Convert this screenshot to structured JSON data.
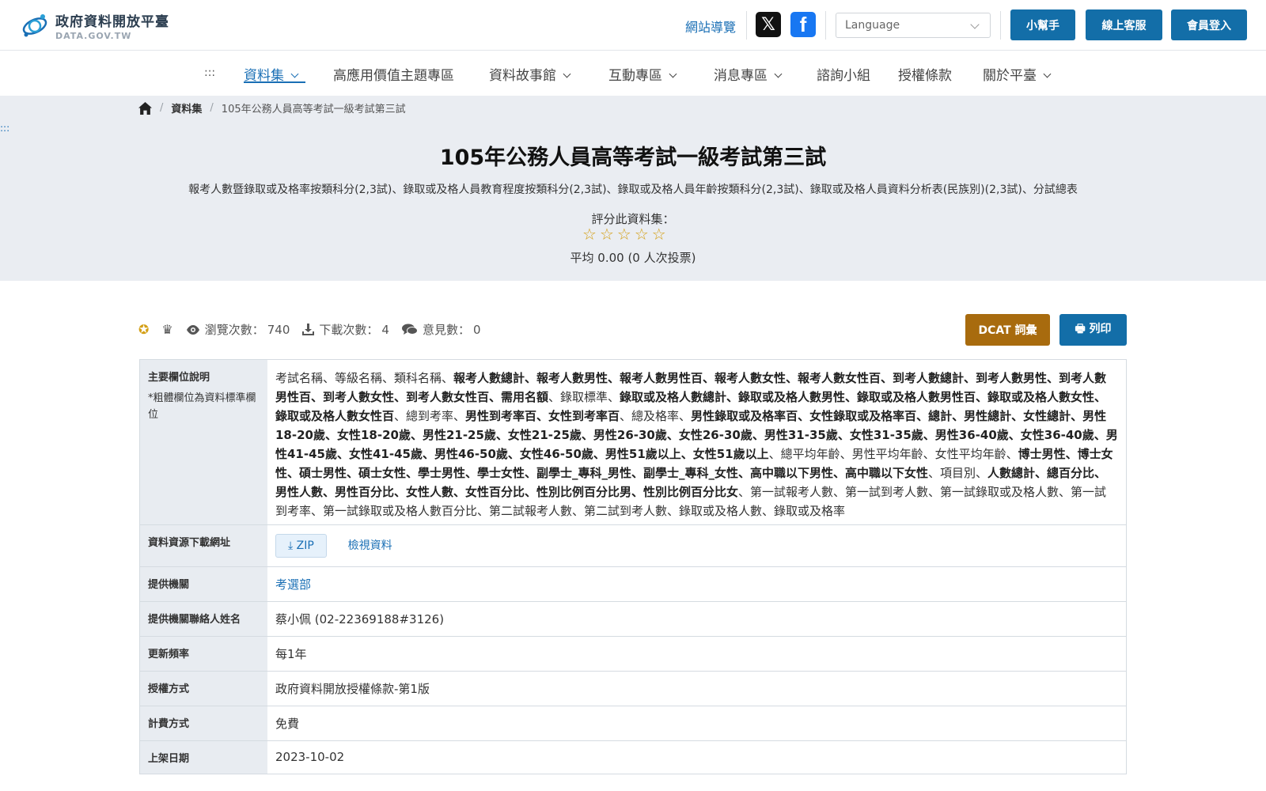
{
  "header": {
    "logo_title": "政府資料開放平臺",
    "logo_sub": "DATA.GOV.TW",
    "sitemap": "網站導覽",
    "social_x": "𝕏",
    "social_fb": "f",
    "language_placeholder": "Language",
    "helper": "小幫手",
    "service": "線上客服",
    "login": "會員登入"
  },
  "nav": {
    "accesskey": ":::",
    "items": [
      "資料集",
      "高應用價值主題專區",
      "資料故事館",
      "互動專區",
      "消息專區",
      "諮詢小組",
      "授權條款",
      "關於平臺"
    ]
  },
  "hero": {
    "accesskey": ":::",
    "breadcrumb": {
      "sep": "/",
      "level1": "資料集",
      "current": "105年公務人員高等考試一級考試第三試"
    },
    "title": "105年公務人員高等考試一級考試第三試",
    "description": "報考人數暨錄取或及格率按類科分(2,3試)、錄取或及格人員教育程度按類科分(2,3試)、錄取或及格人員年齡按類科分(2,3試)、錄取或及格人員資料分析表(民族別)(2,3試)、分試總表",
    "rate_label": "評分此資料集：",
    "stars": [
      "☆",
      "☆",
      "☆",
      "☆",
      "☆"
    ],
    "rating": 0.0,
    "rate_avg": "平均 0.00 (0 人次投票)"
  },
  "stats": {
    "badge_icon": "✪",
    "crown_icon": "♛",
    "views_label": "瀏覽次數：",
    "views": "740",
    "downloads_label": "下載次數：",
    "downloads": "4",
    "comments_label": "意見數：",
    "comments": "0",
    "dcat": "DCAT 詞彙",
    "print": "列印"
  },
  "meta": {
    "fields_label": "主要欄位說明",
    "fields_note": "*粗體欄位為資料標準欄位",
    "fields": [
      {
        "t": "考試名稱、等級名稱、類科名稱、",
        "b": false
      },
      {
        "t": "報考人數總計、報考人數男性、報考人數男性百、報考人數女性、報考人數女性百、到考人數總計、到考人數男性、到考人數男性百、到考人數女性、到考人數女性百、需用名額",
        "b": true
      },
      {
        "t": "、錄取標準、",
        "b": false
      },
      {
        "t": "錄取或及格人數總計、錄取或及格人數男性、錄取或及格人數男性百、錄取或及格人數女性、錄取或及格人數女性百",
        "b": true
      },
      {
        "t": "、總到考率、",
        "b": false
      },
      {
        "t": "男性到考率百、女性到考率百",
        "b": true
      },
      {
        "t": "、總及格率、",
        "b": false
      },
      {
        "t": "男性錄取或及格率百、女性錄取或及格率百、總計、男性總計、女性總計、男性18-20歲、女性18-20歲、男性21-25歲、女性21-25歲、男性26-30歲、女性26-30歲、男性31-35歲、女性31-35歲、男性36-40歲、女性36-40歲、男性41-45歲、女性41-45歲、男性46-50歲、女性46-50歲、男性51歲以上、女性51歲以上",
        "b": true
      },
      {
        "t": "、總平均年齡、男性平均年齡、女性平均年齡、",
        "b": false
      },
      {
        "t": "博士男性、博士女性、碩士男性、碩士女性、學士男性、學士女性、副學士_專科_男性、副學士_專科_女性、高中職以下男性、高中職以下女性",
        "b": true
      },
      {
        "t": "、項目別、",
        "b": false
      },
      {
        "t": "人數總計、總百分比、男性人數、男性百分比、女性人數、女性百分比、性別比例百分比男、性別比例百分比女",
        "b": true
      },
      {
        "t": "、第一試報考人數、第一試到考人數、第一試錄取或及格人數、第一試到考率、第一試錄取或及格人數百分比、第二試報考人數、第二試到考人數、錄取或及格人數、錄取或及格率",
        "b": false
      }
    ],
    "download_label": "資料資源下載網址",
    "zip": "ZIP",
    "view": "檢視資料",
    "org_label": "提供機關",
    "org": "考選部",
    "contact_label": "提供機關聯絡人姓名",
    "contact": "蔡小佩 (02-22369188#3126)",
    "freq_label": "更新頻率",
    "freq": "每1年",
    "license_label": "授權方式",
    "license": "政府資料開放授權條款-第1版",
    "fee_label": "計費方式",
    "fee": "免費",
    "date_label": "上架日期",
    "date": "2023-10-02"
  },
  "colors": {
    "primary": "#136ea8",
    "link": "#1a6fb5",
    "dcat": "#a86b0e",
    "hero_bg": "#eaedf2",
    "star": "#d4a017"
  }
}
